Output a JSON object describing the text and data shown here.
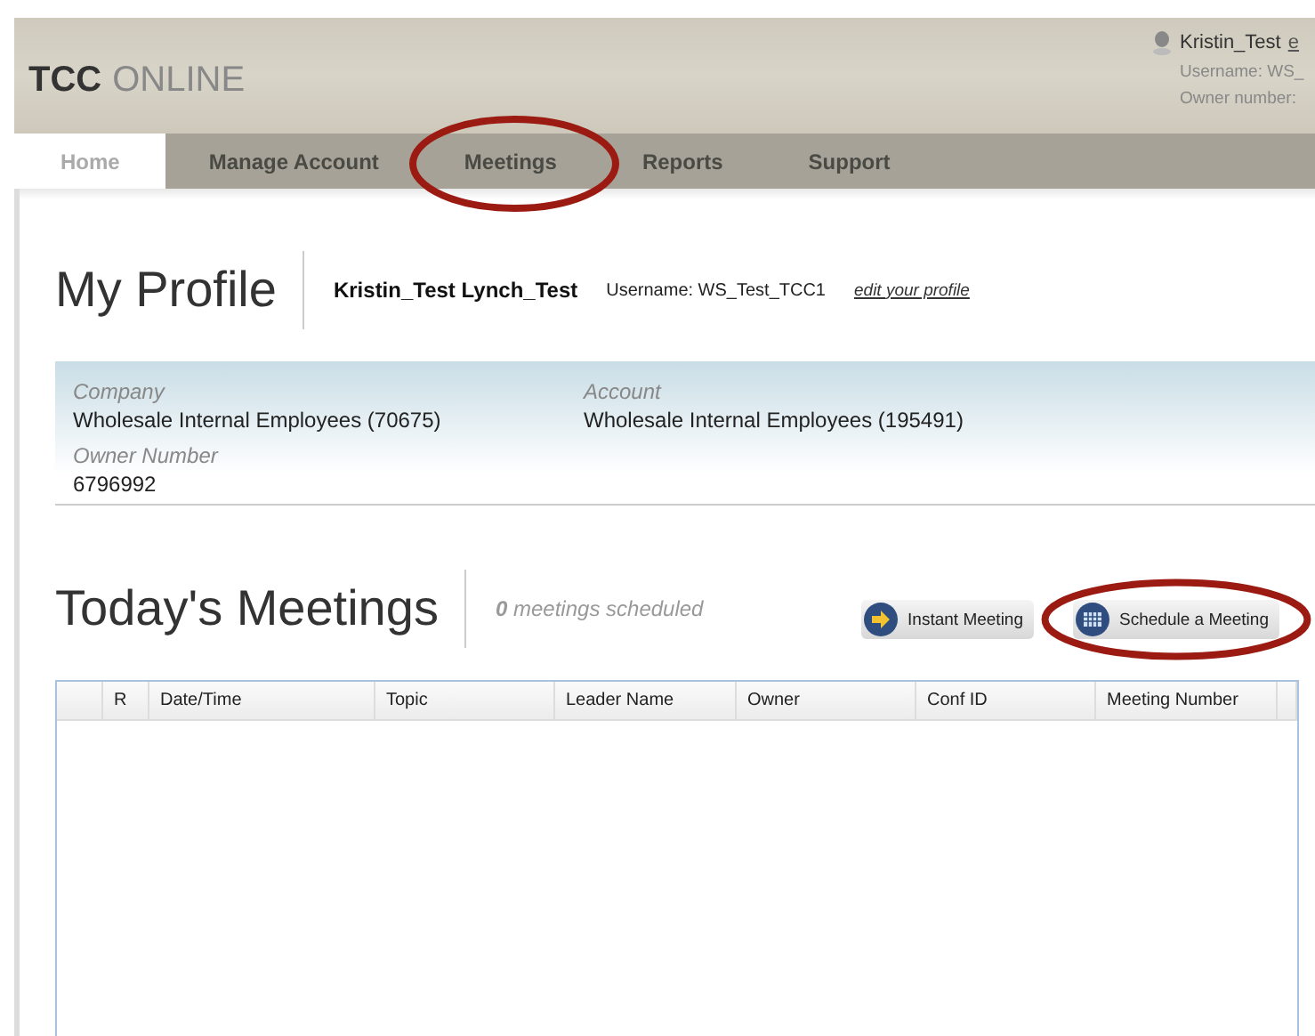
{
  "header": {
    "logo_bold": "TCC",
    "logo_light": "ONLINE",
    "user": {
      "name": "Kristin_Test",
      "link": "e",
      "username": "Username: WS_",
      "owner": "Owner number:"
    }
  },
  "nav": [
    {
      "label": "Home",
      "selected": true
    },
    {
      "label": "Manage Account",
      "selected": false
    },
    {
      "label": "Meetings",
      "selected": false
    },
    {
      "label": "Reports",
      "selected": false
    },
    {
      "label": "Support",
      "selected": false
    }
  ],
  "profile": {
    "title": "My Profile",
    "full_name": "Kristin_Test Lynch_Test",
    "username": "Username: WS_Test_TCC1",
    "edit_link": "edit your profile",
    "fields": [
      {
        "label": "Company",
        "value": "Wholesale Internal Employees (70675)"
      },
      {
        "label": "Account",
        "value": "Wholesale Internal Employees (195491)"
      },
      {
        "label": "Owner Number",
        "value": "6796992"
      }
    ]
  },
  "meetings": {
    "title": "Today's Meetings",
    "count": "0",
    "count_text": "meetings scheduled",
    "buttons": [
      {
        "kind": "instant",
        "label": "Instant Meeting"
      },
      {
        "kind": "schedule",
        "label": "Schedule a Meeting"
      }
    ],
    "columns": [
      "R",
      "Date/Time",
      "Topic",
      "Leader Name",
      "Owner",
      "Conf ID",
      "Meeting Number"
    ]
  }
}
